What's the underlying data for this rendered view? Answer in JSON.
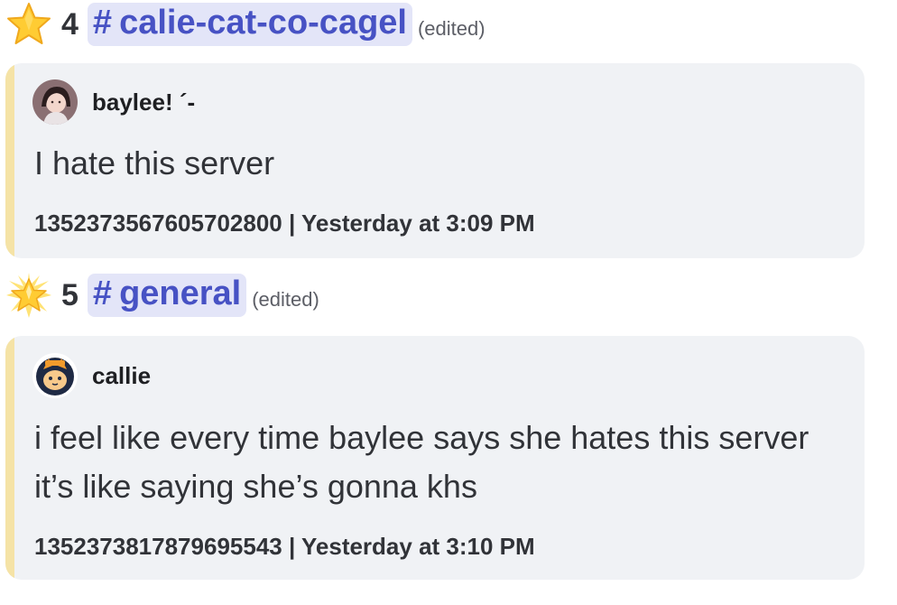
{
  "entries": [
    {
      "rank": "4",
      "channel": "calie-cat-co-cagel",
      "edited_label": "(edited)",
      "author": "baylee! ´-",
      "message": "I hate this server",
      "footer": "1352373567605702800 | Yesterday at 3:09 PM",
      "star_icon": "star-emoji"
    },
    {
      "rank": "5",
      "channel": "general",
      "edited_label": "(edited)",
      "author": "callie",
      "message": "i feel like every time baylee says she hates this server it’s like saying she’s gonna khs",
      "footer": "1352373817879695543 | Yesterday at 3:10 PM",
      "star_icon": "glowing-star-emoji"
    }
  ],
  "colors": {
    "mention_bg": "#e3e5f8",
    "mention_text": "#4752c4",
    "card_bg": "#f0f2f5",
    "card_accent": "#f5e3a6"
  }
}
